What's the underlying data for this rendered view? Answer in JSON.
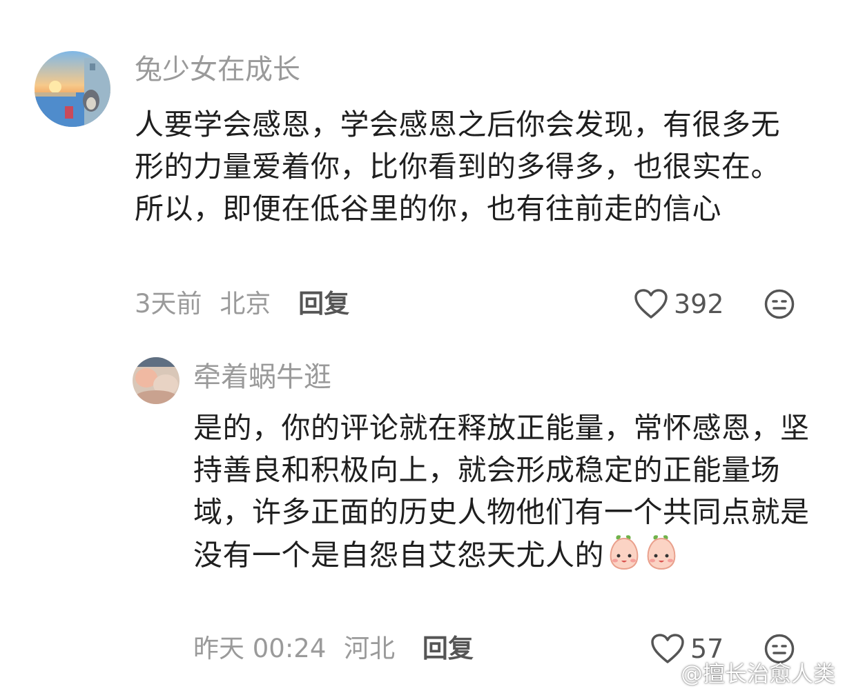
{
  "comments": [
    {
      "username": "兔少女在成长",
      "text": "人要学会感恩，学会感恩之后你会发现，有很多无形的力量爱着你，比你看到的多得多，也很实在。所以，即便在低谷里的你，也有往前走的信心",
      "time": "3天前",
      "location": "北京",
      "reply_label": "回复",
      "likes": "392",
      "avatar_icon": "avatar-sunset-totoro"
    },
    {
      "username": "牵着蜗牛逛",
      "text": "是的，你的评论就在释放正能量，常怀感恩，坚持善良和积极向上，就会形成稳定的正能量场域，许多正面的历史人物他们有一个共同点就是没有一个是自怨自艾怨天尤人的",
      "time": "昨天 00:24",
      "location": "河北",
      "reply_label": "回复",
      "likes": "57",
      "avatar_icon": "avatar-blurry-photo",
      "emojis": [
        "peach-face-emoji",
        "peach-face-emoji"
      ]
    }
  ],
  "watermark": "@擅长治愈人类",
  "colors": {
    "meta_gray": "#9a9a9a",
    "text_dark": "#1f1f1f",
    "reply_gray": "#555555",
    "emoji_pink": "#f7b7a8"
  }
}
